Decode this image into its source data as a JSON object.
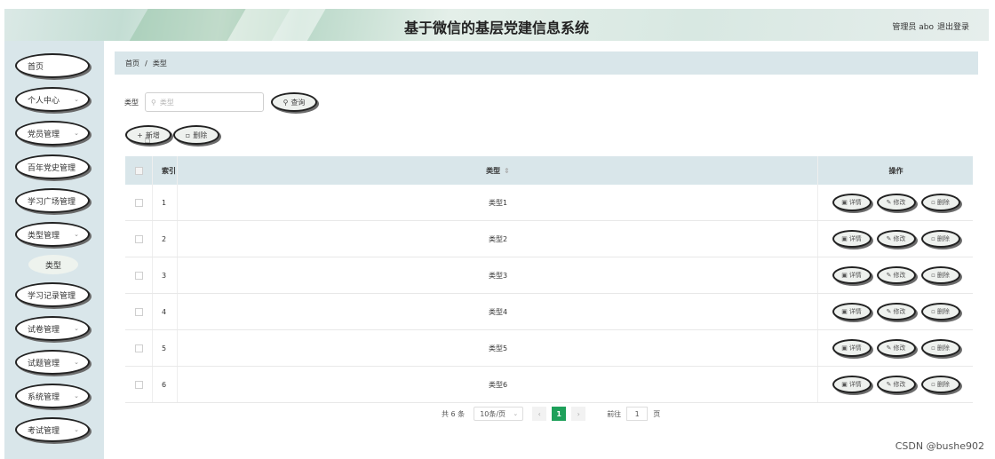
{
  "header": {
    "title": "基于微信的基层党建信息系统",
    "admin": "管理员 abo",
    "logout": "退出登录"
  },
  "sidebar": {
    "items": [
      {
        "label": "首页",
        "has_chevron": false
      },
      {
        "label": "个人中心",
        "has_chevron": true
      },
      {
        "label": "党员管理",
        "has_chevron": true
      },
      {
        "label": "百年党史管理",
        "has_chevron": false
      },
      {
        "label": "学习广场管理",
        "has_chevron": false
      },
      {
        "label": "类型管理",
        "has_chevron": true
      },
      {
        "label": "学习记录管理",
        "has_chevron": false
      },
      {
        "label": "试卷管理",
        "has_chevron": true
      },
      {
        "label": "试题管理",
        "has_chevron": true
      },
      {
        "label": "系统管理",
        "has_chevron": true
      },
      {
        "label": "考试管理",
        "has_chevron": true
      }
    ],
    "sub_item": "类型"
  },
  "breadcrumb": {
    "home": "首页",
    "separator": "/",
    "current": "类型"
  },
  "search": {
    "label": "类型",
    "placeholder": "类型",
    "query_button": "查询"
  },
  "toolbar": {
    "add_button": "新增",
    "delete_button": "删除"
  },
  "table": {
    "headers": {
      "index": "索引",
      "type": "类型",
      "actions": "操作"
    },
    "rows": [
      {
        "index": "1",
        "type": "类型1"
      },
      {
        "index": "2",
        "type": "类型2"
      },
      {
        "index": "3",
        "type": "类型3"
      },
      {
        "index": "4",
        "type": "类型4"
      },
      {
        "index": "5",
        "type": "类型5"
      },
      {
        "index": "6",
        "type": "类型6"
      }
    ],
    "actions": {
      "detail": "详情",
      "edit": "修改",
      "delete": "删除"
    }
  },
  "pagination": {
    "total": "共 6 条",
    "page_size": "10条/页",
    "current_page": "1",
    "goto_label": "前往",
    "goto_value": "1",
    "goto_unit": "页"
  },
  "watermark": "CSDN @bushe902",
  "colors": {
    "accent_green": "#1ea05a",
    "sidebar_bg": "#d9e6ea",
    "table_header_bg": "#d9e6ea"
  }
}
